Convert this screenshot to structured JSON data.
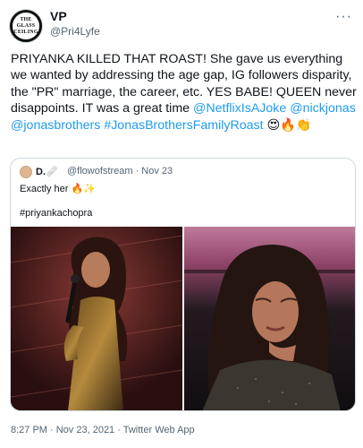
{
  "tweet": {
    "display_name": "VP",
    "handle": "@Pri4Lyfe",
    "avatar_text": [
      "THE",
      "GLASS",
      "CEILING"
    ],
    "more_label": "···",
    "text_parts": [
      {
        "type": "text",
        "value": "PRIYANKA KILLED THAT ROAST! She gave us everything we wanted by addressing the age gap, IG followers disparity, the \"PR\" marriage, the career, etc. YES BABE! QUEEN never disappoints. IT was a great time "
      },
      {
        "type": "mention",
        "value": "@NetflixIsAJoke"
      },
      {
        "type": "text",
        "value": " "
      },
      {
        "type": "mention",
        "value": "@nickjonas"
      },
      {
        "type": "text",
        "value": " "
      },
      {
        "type": "mention",
        "value": "@jonasbrothers"
      },
      {
        "type": "text",
        "value": " "
      },
      {
        "type": "mention",
        "value": "#JonasBrothersFamilyRoast"
      },
      {
        "type": "text",
        "value": " 😍🔥👏"
      }
    ],
    "timestamp": "8:27 PM · Nov 23, 2021 · Twitter Web App"
  },
  "quote": {
    "display_name": "D.🩹",
    "handle_time": "@flowofstream · Nov 23",
    "text": "Exactly her 🔥✨",
    "hashtag": "#priyankachopra"
  },
  "colors": {
    "link": "#1d9bf0",
    "secondary": "#536471",
    "border": "#cfd9de"
  }
}
